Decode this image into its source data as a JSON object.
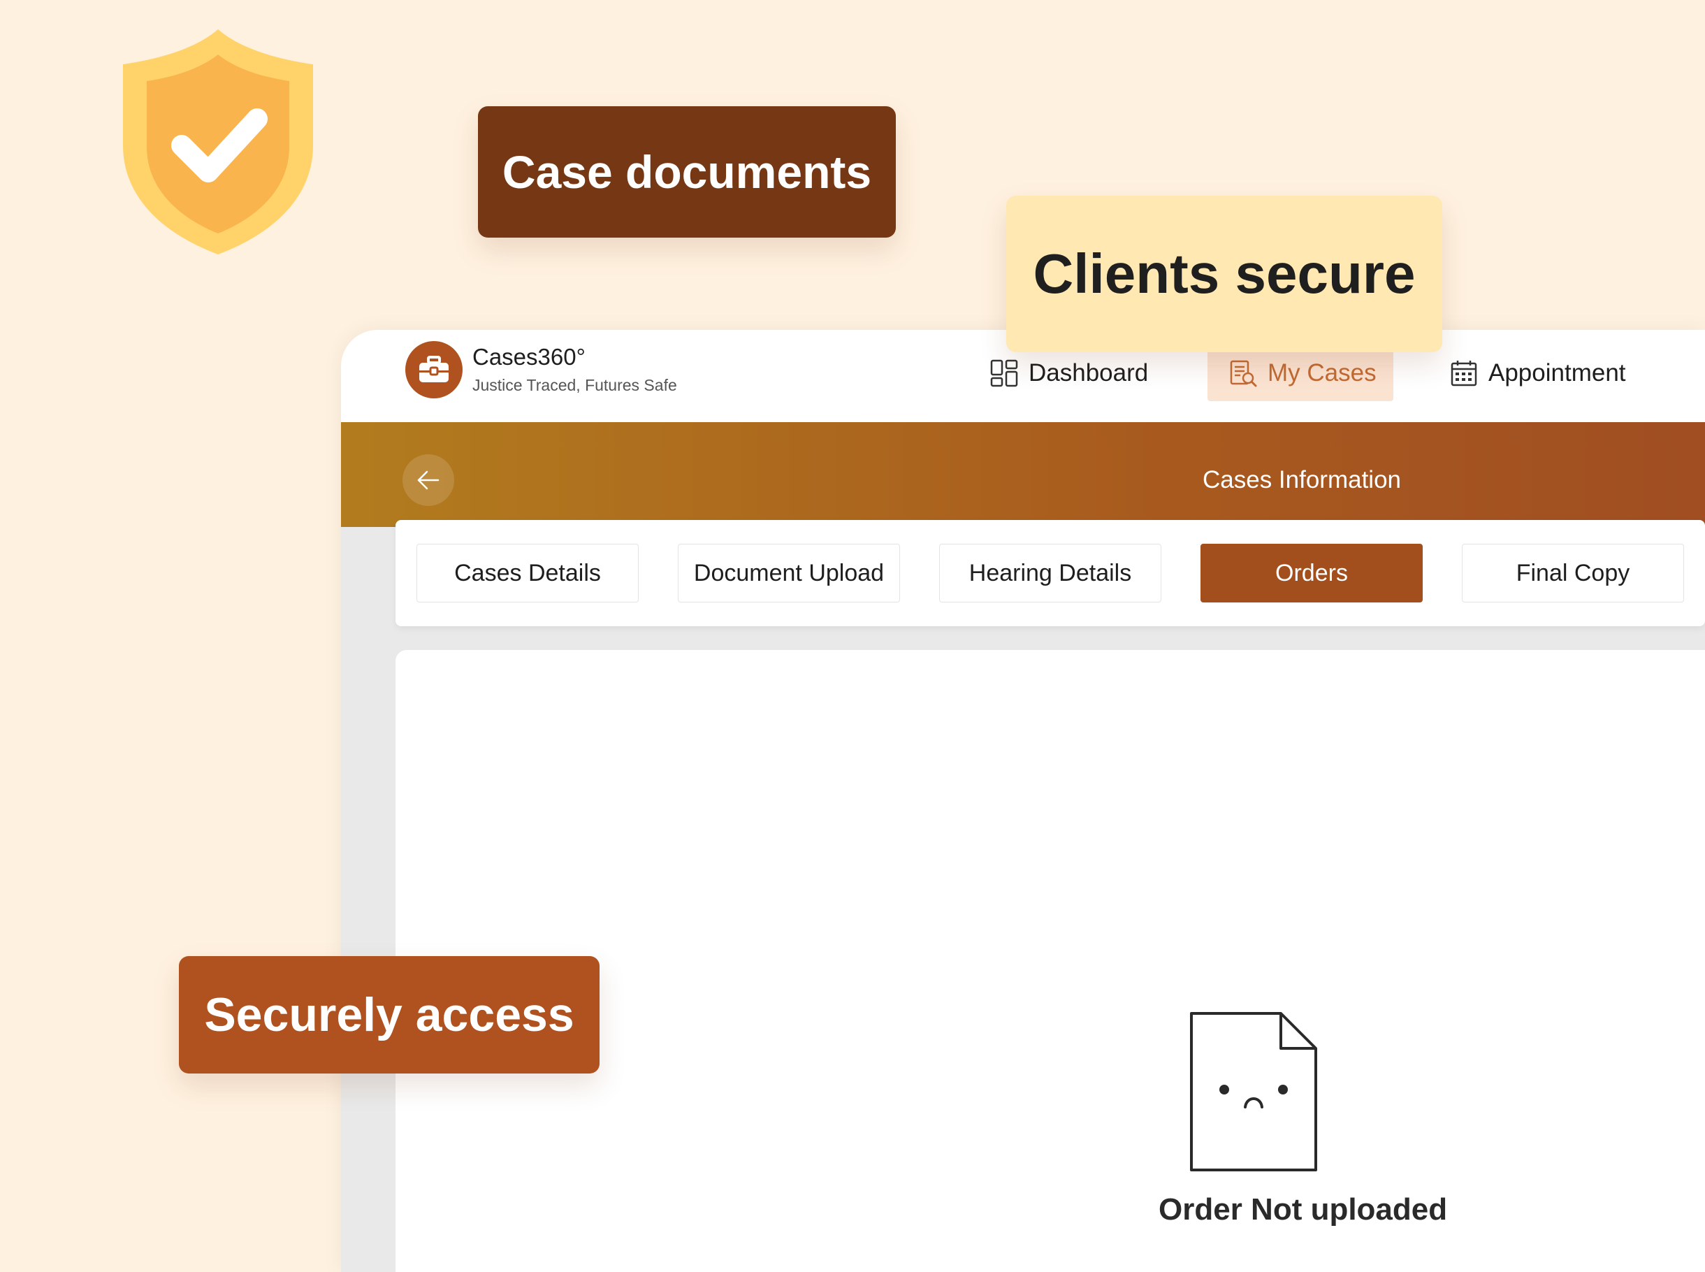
{
  "callouts": {
    "case_documents": "Case documents",
    "clients_secure": "Clients secure",
    "securely_access": "Securely access"
  },
  "brand": {
    "name": "Cases360°",
    "tagline": "Justice Traced, Futures Safe",
    "logo_icon": "briefcase-icon"
  },
  "nav": {
    "items": [
      {
        "label": "Dashboard",
        "icon": "dashboard-icon",
        "active": false
      },
      {
        "label": "My Cases",
        "icon": "cases-icon",
        "active": true
      },
      {
        "label": "Appointment",
        "icon": "calendar-icon",
        "active": false
      }
    ]
  },
  "banner": {
    "title": "Cases Information",
    "back_icon": "arrow-left-icon"
  },
  "tabs": [
    {
      "label": "Cases Details",
      "active": false
    },
    {
      "label": "Document Upload",
      "active": false
    },
    {
      "label": "Hearing Details",
      "active": false
    },
    {
      "label": "Orders",
      "active": true
    },
    {
      "label": "Final Copy",
      "active": false
    }
  ],
  "empty_state": {
    "message": "Order Not uploaded",
    "icon": "sad-document-icon"
  },
  "colors": {
    "page_background": "#fff1e0",
    "brand_dark": "#763814",
    "brand_accent": "#b0521f",
    "highlight_yellow": "#ffe8b2",
    "active_tab": "#a24f1d",
    "shield_outer": "#ffd36a",
    "shield_inner": "#f9b44e"
  }
}
